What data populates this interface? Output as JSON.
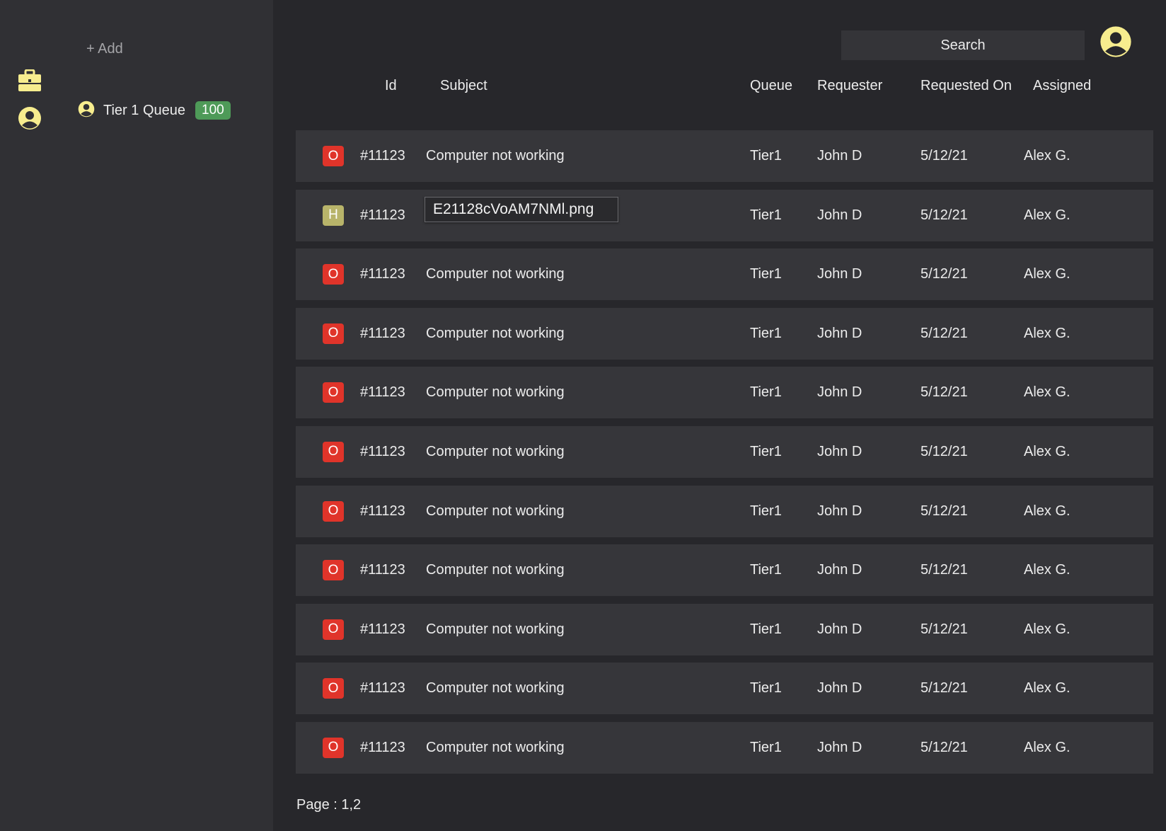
{
  "colors": {
    "accent_icon": "#f7ed8e",
    "priority_o": "#e0342a",
    "priority_h": "#b8b46a",
    "count_badge": "#4e9a58"
  },
  "sidebar": {
    "rail_icons": [
      "briefcase-icon",
      "user-icon"
    ],
    "add_label": "+ Add",
    "queue": {
      "icon": "user-circle-icon",
      "label": "Tier 1 Queue",
      "count": "100"
    }
  },
  "header": {
    "search_label": "Search",
    "profile_icon": "user-circle-icon"
  },
  "table": {
    "columns": {
      "id": "Id",
      "subject": "Subject",
      "queue": "Queue",
      "requester": "Requester",
      "requested_on": "Requested On",
      "assigned": "Assigned"
    },
    "rows": [
      {
        "priority": "O",
        "id": "#11123",
        "subject": "Computer not working",
        "queue": "Tier1",
        "requester": "John D",
        "requested_on": "5/12/21",
        "assigned": "Alex G."
      },
      {
        "priority": "H",
        "id": "#11123",
        "subject": "",
        "queue": "Tier1",
        "requester": "John D",
        "requested_on": "5/12/21",
        "assigned": "Alex G."
      },
      {
        "priority": "O",
        "id": "#11123",
        "subject": "Computer not working",
        "queue": "Tier1",
        "requester": "John D",
        "requested_on": "5/12/21",
        "assigned": "Alex G."
      },
      {
        "priority": "O",
        "id": "#11123",
        "subject": "Computer not working",
        "queue": "Tier1",
        "requester": "John D",
        "requested_on": "5/12/21",
        "assigned": "Alex G."
      },
      {
        "priority": "O",
        "id": "#11123",
        "subject": "Computer not working",
        "queue": "Tier1",
        "requester": "John D",
        "requested_on": "5/12/21",
        "assigned": "Alex G."
      },
      {
        "priority": "O",
        "id": "#11123",
        "subject": "Computer not working",
        "queue": "Tier1",
        "requester": "John D",
        "requested_on": "5/12/21",
        "assigned": "Alex G."
      },
      {
        "priority": "O",
        "id": "#11123",
        "subject": "Computer not working",
        "queue": "Tier1",
        "requester": "John D",
        "requested_on": "5/12/21",
        "assigned": "Alex G."
      },
      {
        "priority": "O",
        "id": "#11123",
        "subject": "Computer not working",
        "queue": "Tier1",
        "requester": "John D",
        "requested_on": "5/12/21",
        "assigned": "Alex G."
      },
      {
        "priority": "O",
        "id": "#11123",
        "subject": "Computer not working",
        "queue": "Tier1",
        "requester": "John D",
        "requested_on": "5/12/21",
        "assigned": "Alex G."
      },
      {
        "priority": "O",
        "id": "#11123",
        "subject": "Computer not working",
        "queue": "Tier1",
        "requester": "John D",
        "requested_on": "5/12/21",
        "assigned": "Alex G."
      },
      {
        "priority": "O",
        "id": "#11123",
        "subject": "Computer not working",
        "queue": "Tier1",
        "requester": "John D",
        "requested_on": "5/12/21",
        "assigned": "Alex G."
      }
    ]
  },
  "pager_label": "Page : 1,2",
  "tooltip": {
    "filename": "E21128cVoAM7NMl.png"
  }
}
